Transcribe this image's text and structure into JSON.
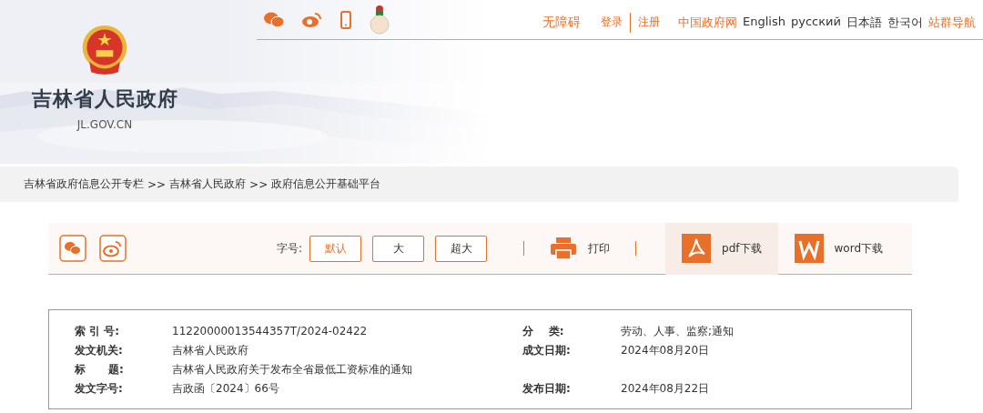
{
  "header": {
    "site_title": "吉林省人民政府",
    "site_domain": "JL.GOV.CN",
    "top_links": [
      "无障碍",
      "登录",
      "注册"
    ],
    "language_links": [
      {
        "label": "中国政府网",
        "highlighted": true
      },
      {
        "label": "English",
        "highlighted": false
      },
      {
        "label": "русский",
        "highlighted": false
      },
      {
        "label": "日本語",
        "highlighted": false
      },
      {
        "label": "한국어",
        "highlighted": false
      },
      {
        "label": "站群导航",
        "highlighted": true
      }
    ]
  },
  "breadcrumb": [
    "吉林省政府信息公开专栏",
    ">>",
    "吉林省人民政府",
    ">>",
    "政府信息公开基础平台"
  ],
  "toolbar": {
    "font_size_label": "字号:",
    "font_sizes": [
      {
        "label": "默认",
        "selected": true
      },
      {
        "label": "大",
        "selected": false
      },
      {
        "label": "超大",
        "selected": false
      }
    ],
    "print_label": "打印",
    "downloads": [
      {
        "kind": "pdf",
        "label": "pdf下载"
      },
      {
        "kind": "word",
        "label": "word下载"
      }
    ]
  },
  "info": {
    "rows": [
      {
        "cells": [
          {
            "label": "索 引 号:",
            "value": "11220000013544357T/2024-02422"
          },
          {
            "label": "分    类:",
            "value": "劳动、人事、监察;通知"
          }
        ]
      },
      {
        "cells": [
          {
            "label": "发文机关:",
            "value": "吉林省人民政府"
          },
          {
            "label": "成文日期:",
            "value": "2024年08月20日"
          }
        ]
      },
      {
        "cells": [
          {
            "label": "标      题:",
            "value": "吉林省人民政府关于发布全省最低工资标准的通知"
          }
        ]
      },
      {
        "cells": [
          {
            "label": "发文字号:",
            "value": "吉政函〔2024〕66号"
          },
          {
            "label": "发布日期:",
            "value": "2024年08月22日"
          }
        ]
      }
    ]
  }
}
